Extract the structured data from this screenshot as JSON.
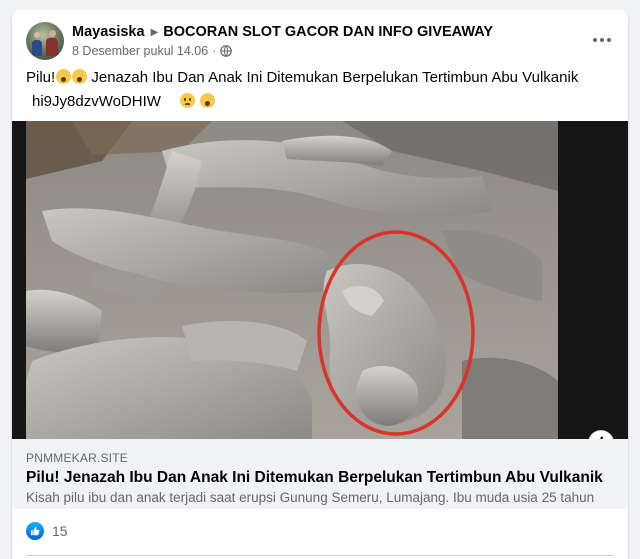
{
  "post": {
    "author": "Mayasiska",
    "group": "BOCORAN SLOT GACOR DAN INFO GIVEAWAY",
    "date": "8 Desember pukul 14.06",
    "separator": "·",
    "more_label": "•••",
    "message_line1": "Pilu!",
    "message_line1_rest": " Jenazah Ibu Dan Anak Ini Ditemukan Berpelukan Tertimbun Abu Vulkanik",
    "message_line2": "hi9Jy8dzvWoDHIW",
    "icons": {
      "privacy": "globe-icon",
      "author_arrow": "caret-right-icon",
      "more": "more-options-icon",
      "emoji1": "screaming-face-icon",
      "emoji2": "sad-face-icon"
    }
  },
  "link_preview": {
    "domain": "PNMMEKAR.SITE",
    "title": "Pilu! Jenazah Ibu Dan Anak Ini Ditemukan Berpelukan Tertimbun Abu Vulkanik",
    "description": "Kisah pilu ibu dan anak terjadi saat erupsi Gunung Semeru, Lumajang. Ibu muda usia 25 tahun",
    "info_label": "i"
  },
  "footer": {
    "like_count": "15"
  },
  "colors": {
    "like_blue": "#1877f2",
    "secondary_text": "#65676b",
    "highlight_circle": "#d9342b"
  }
}
